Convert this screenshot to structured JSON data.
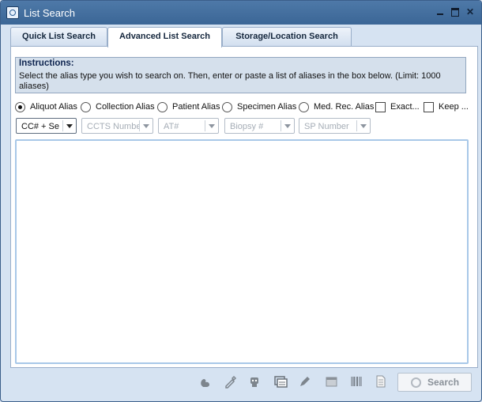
{
  "window": {
    "title": "List Search",
    "close_glyph": "✕"
  },
  "tabs": [
    {
      "label": "Quick List Search",
      "active": false
    },
    {
      "label": "Advanced List Search",
      "active": true
    },
    {
      "label": "Storage/Location Search",
      "active": false
    }
  ],
  "instructions": {
    "heading": "Instructions:",
    "text": "Select the alias type you wish to search on. Then, enter or paste a list of aliases in the box below. (Limit: 1000 aliases)"
  },
  "alias_options": [
    {
      "label": "Aliquot Alias",
      "selected": true
    },
    {
      "label": "Collection Alias",
      "selected": false
    },
    {
      "label": "Patient Alias",
      "selected": false
    },
    {
      "label": "Specimen Alias",
      "selected": false
    },
    {
      "label": "Med. Rec. Alias",
      "selected": false
    }
  ],
  "checkboxes": [
    {
      "label": "Exact...",
      "checked": false
    },
    {
      "label": "Keep ...",
      "checked": false
    }
  ],
  "combos": [
    {
      "value": "CC# + Se",
      "enabled": true
    },
    {
      "value": "CCTS Numbe",
      "enabled": false
    },
    {
      "value": "AT#",
      "enabled": false
    },
    {
      "value": "Biopsy #",
      "enabled": false
    },
    {
      "value": "SP Number",
      "enabled": false
    }
  ],
  "aliases_input": {
    "value": ""
  },
  "toolbar_icons": [
    "squirrel-icon",
    "pipette-icon",
    "robot-icon",
    "window-list-icon",
    "pen-icon",
    "calendar-icon",
    "barcode-icon",
    "document-icon"
  ],
  "search_button": {
    "label": "Search"
  },
  "colors": {
    "title_bar": "#4a74a3",
    "instructions_bg": "#d5e0ec",
    "textarea_border": "#a8c8e8"
  }
}
